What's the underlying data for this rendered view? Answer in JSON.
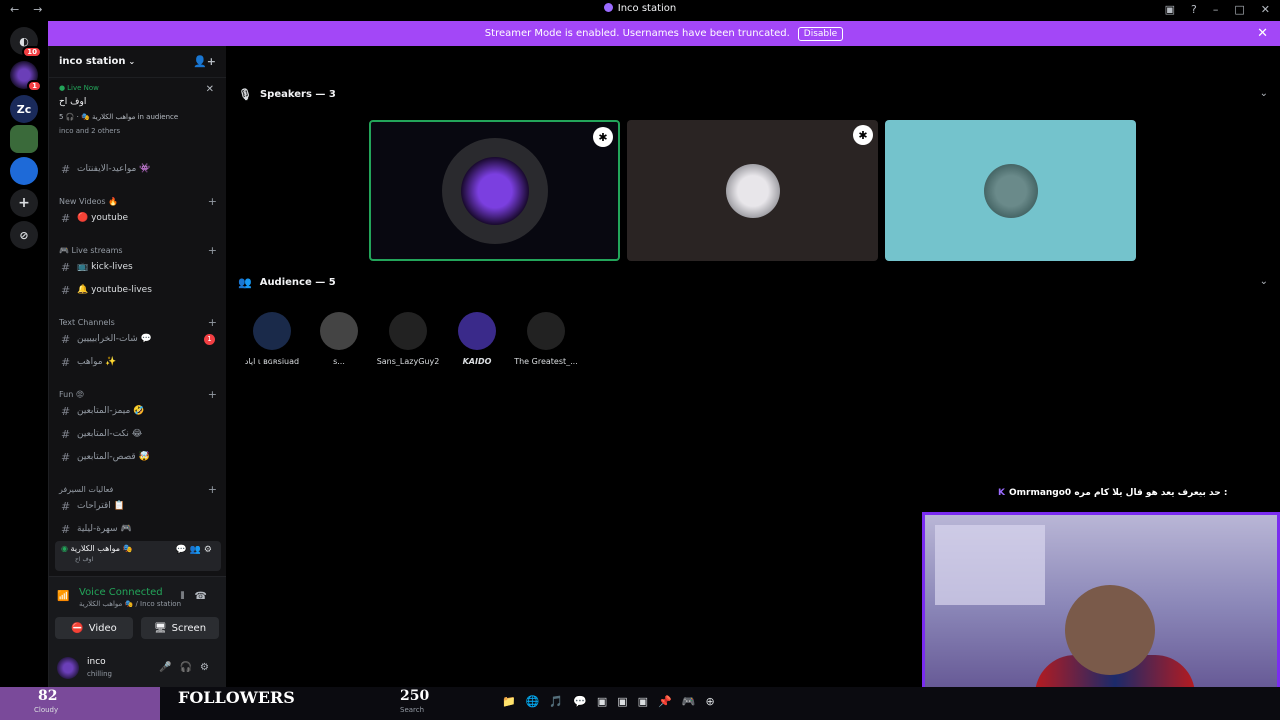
{
  "window": {
    "title": "Inco station",
    "nav_back": "←",
    "nav_fwd": "→",
    "controls": [
      "▣",
      "?",
      "–",
      "□",
      "✕"
    ]
  },
  "banner": {
    "text": "Streamer Mode is enabled. Usernames have been truncated.",
    "button": "Disable",
    "close": "✕"
  },
  "rail": {
    "home_badge": "10",
    "server_badge": "1",
    "zc_label": "Zc",
    "add_icon": "+",
    "explore_icon": "⊘"
  },
  "sidebar": {
    "server_name": "inco station",
    "live": {
      "label": "Live Now",
      "title": "اوف اح",
      "meta": "مواهب الكلارية 🎭 · 🎧 5 in audience",
      "people": "inco and 2 others",
      "close": "✕"
    },
    "channels": [
      {
        "name": "مواعيد-الايفنتات 👾",
        "type": "#"
      },
      {
        "category": "New Videos 🔥"
      },
      {
        "name": "🔴 youtube",
        "type": "#"
      },
      {
        "category": "🎮 Live streams"
      },
      {
        "name": "📺 kick-lives",
        "type": "#"
      },
      {
        "name": "🔔 youtube-lives",
        "type": "#"
      },
      {
        "category": "Text Channels"
      },
      {
        "name": "شات-الخرابيييين 💬",
        "type": "#",
        "mentions": "1"
      },
      {
        "name": "مواهب ✨",
        "type": "#"
      },
      {
        "category": "Fun 😡"
      },
      {
        "name": "ميمز-المتابعين 🤣",
        "type": "#"
      },
      {
        "name": "نكت-المتابعين 😂",
        "type": "#"
      },
      {
        "name": "قصص-المتابعين 🤯",
        "type": "#"
      },
      {
        "category": "فعاليات السيرفر"
      },
      {
        "name": "اقتراحات 📋",
        "type": "#"
      },
      {
        "name": "سهرة-ليلية 🎮",
        "type": "#"
      }
    ],
    "voice_channel": {
      "name": "مواهب الكلارية 🎭",
      "sub": "اوف اح"
    },
    "voice": {
      "status": "Voice Connected",
      "where": "مواهب الكلارية 🎭 / Inco station",
      "video_label": "Video",
      "screen_label": "Screen"
    },
    "user": {
      "name": "inco",
      "status": "chilling"
    }
  },
  "stage": {
    "speakers_title": "Speakers — 3",
    "audience_title": "Audience — 5",
    "audience": [
      {
        "name": "اياد ι ʙɢʀsiuad",
        "color": "#1a2a4a"
      },
      {
        "name": "s...",
        "color": "#444"
      },
      {
        "name": "Sans_LazyGuy2",
        "color": "#000"
      },
      {
        "name": "KAIDO",
        "color": "#3a2a8a"
      },
      {
        "name": "The Greatest_...",
        "color": "#000"
      }
    ]
  },
  "overlay": {
    "chat_user": "Omrmango0",
    "chat_text": "حد بيعرف يعد هو قال يلا كام مره :",
    "followers_num": "82",
    "weather": "Cloudy",
    "followers_label": "FOLLOWERS",
    "followers_count": "250",
    "search_label": "Search"
  },
  "colors": {
    "accent": "#a347f7",
    "live_green": "#23a55a",
    "mention_red": "#f23f43"
  }
}
